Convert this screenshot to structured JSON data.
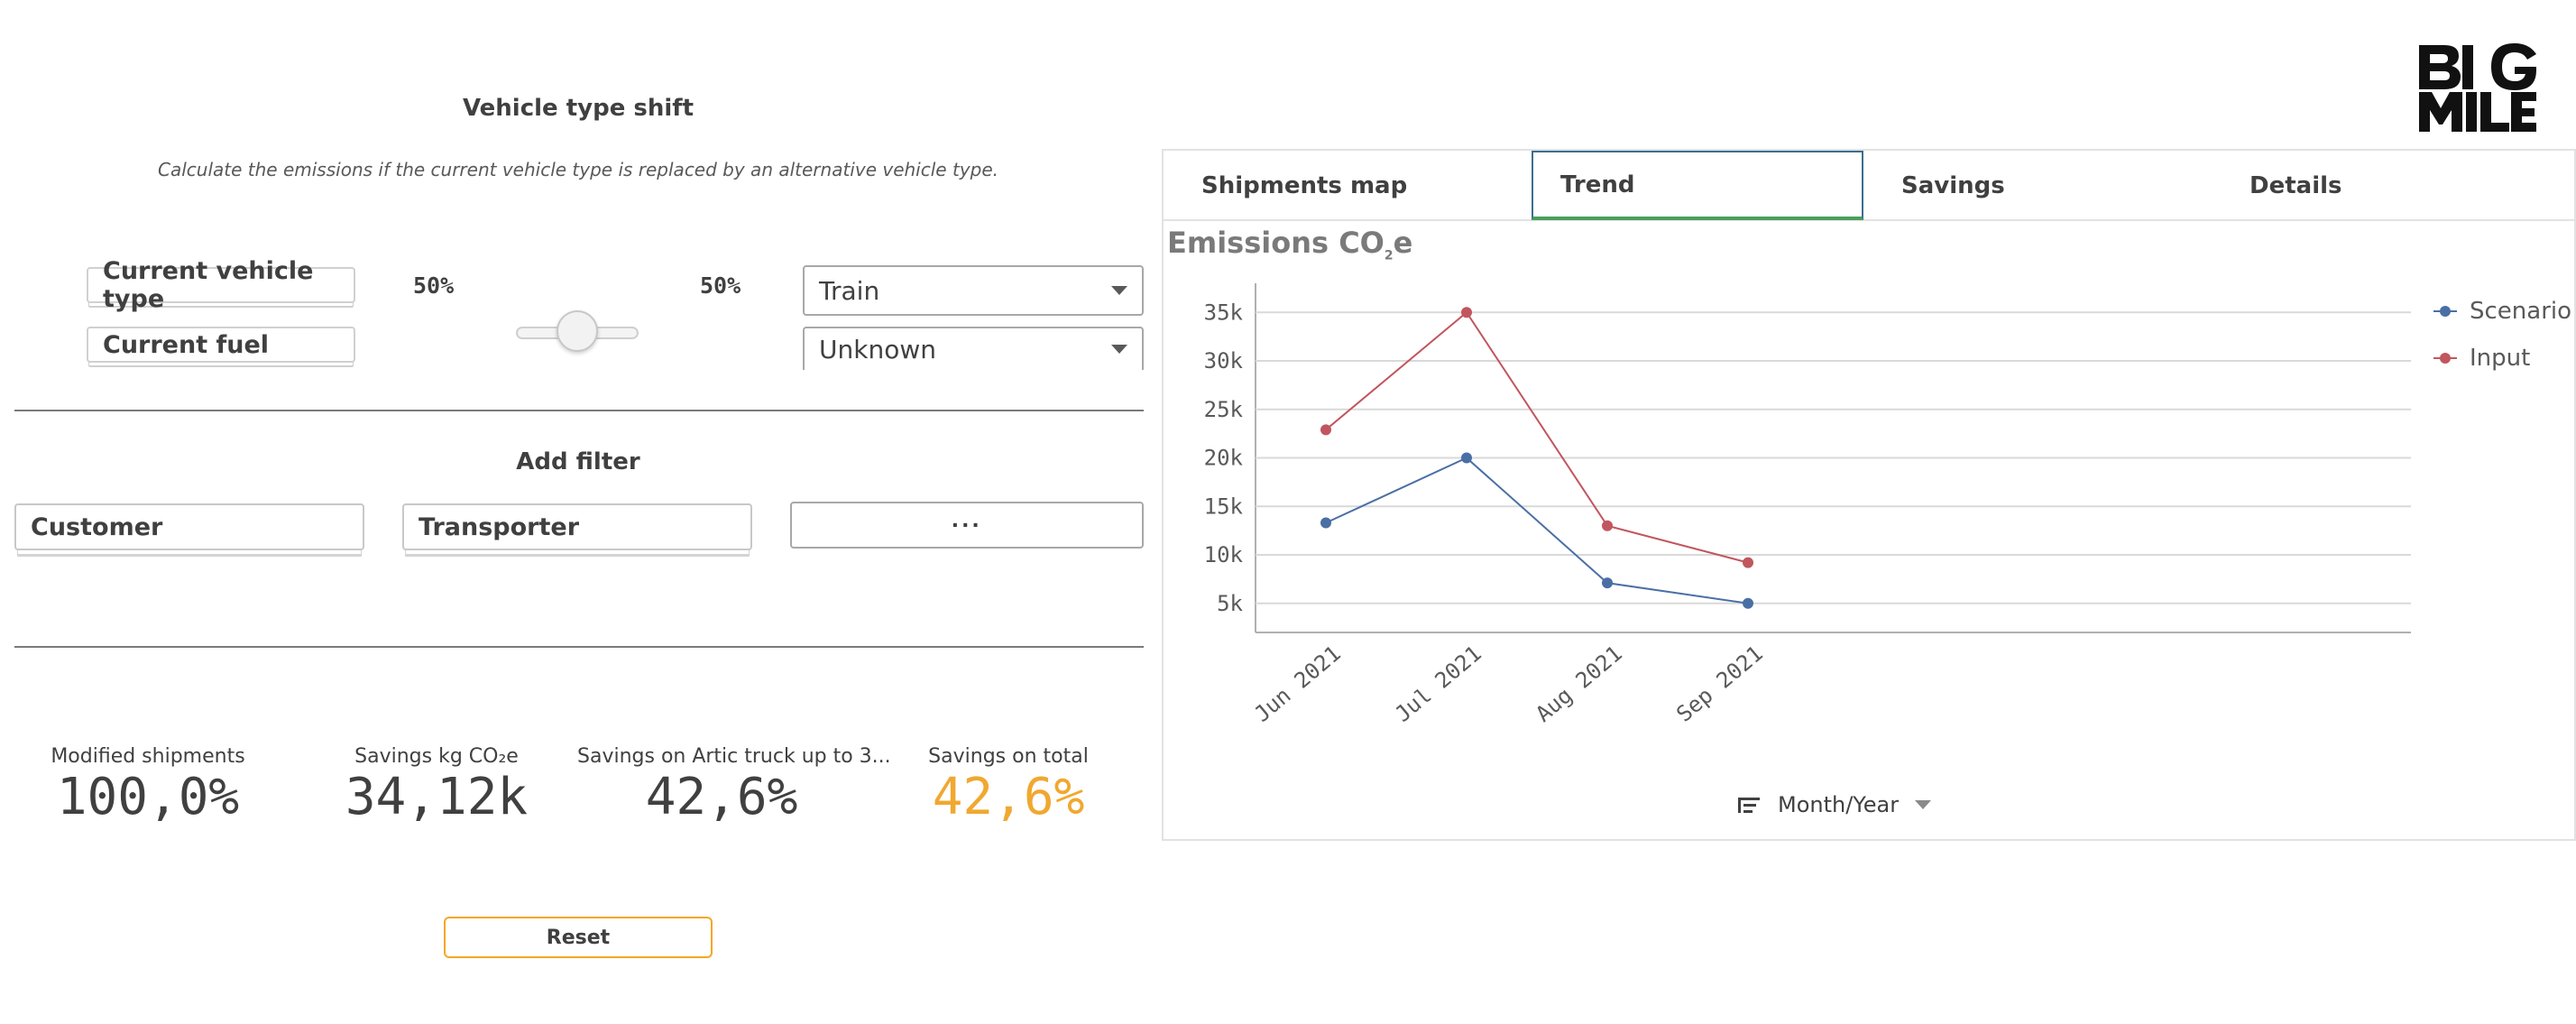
{
  "header": {
    "title": "Vehicle type shift",
    "subtitle": "Calculate the emissions if the current vehicle type is replaced by an alternative vehicle type."
  },
  "brand": {
    "logo_text": "BIG MILE"
  },
  "vehicle_shift": {
    "current_vehicle_label": "Current vehicle type",
    "current_fuel_label": "Current fuel",
    "left_pct": "50%",
    "right_pct": "50%",
    "slider_value": 0.5,
    "alt_vehicle_value": "Train",
    "alt_fuel_value": "Unknown"
  },
  "filters": {
    "title": "Add filter",
    "customer_label": "Customer",
    "transporter_label": "Transporter",
    "more_label": "···"
  },
  "kpis": [
    {
      "label": "Modified shipments",
      "value": "100,0%",
      "color": "#404040"
    },
    {
      "label": "Savings kg CO₂e",
      "value": "34,12k",
      "color": "#404040"
    },
    {
      "label": "Savings on Artic truck up to 3...",
      "value": "42,6%",
      "color": "#404040"
    },
    {
      "label": "Savings on total",
      "value": "42,6%",
      "color": "#f0a830"
    }
  ],
  "reset_label": "Reset",
  "tabs": [
    {
      "label": "Shipments map",
      "active": false
    },
    {
      "label": "Trend",
      "active": true
    },
    {
      "label": "Savings",
      "active": false
    },
    {
      "label": "Details",
      "active": false
    }
  ],
  "chart": {
    "title_main": "Emissions CO",
    "title_sub": "2",
    "title_end": "e",
    "dimension_label": "Month/Year"
  },
  "chart_data": {
    "type": "line",
    "title": "Emissions CO2e",
    "x": [
      "Jun 2021",
      "Jul 2021",
      "Aug 2021",
      "Sep 2021"
    ],
    "series": [
      {
        "name": "Scenario",
        "color": "#4a6fa5",
        "values": [
          13300,
          20000,
          7100,
          5000
        ]
      },
      {
        "name": "Input",
        "color": "#c1565e",
        "values": [
          22900,
          35000,
          13000,
          9200
        ]
      }
    ],
    "yticks": [
      "5k",
      "10k",
      "15k",
      "20k",
      "25k",
      "30k",
      "35k"
    ],
    "ylim": [
      5000,
      35000
    ],
    "grid": true,
    "legend": "top-right"
  }
}
